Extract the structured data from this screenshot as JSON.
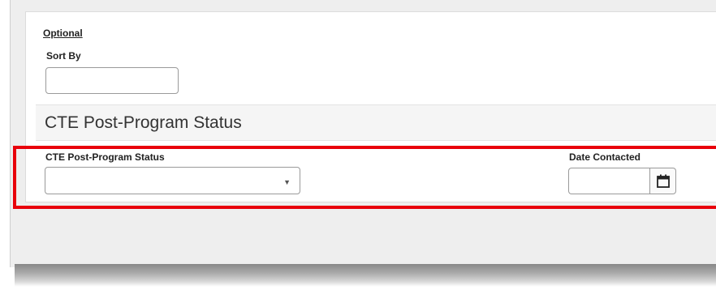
{
  "form": {
    "optional_label": "Optional",
    "sort_by": {
      "label": "Sort By",
      "value": ""
    }
  },
  "section": {
    "title": "CTE Post-Program Status",
    "status_field": {
      "label": "CTE Post-Program Status",
      "selected_value": "",
      "caret_icon": "caret-down-icon"
    },
    "date_field": {
      "label": "Date Contacted",
      "value": "",
      "calendar_icon": "calendar-icon"
    }
  },
  "colors": {
    "highlight": "#e8000b",
    "section_header_bg": "#f5f5f5",
    "frame_bg": "#eeeeee"
  }
}
